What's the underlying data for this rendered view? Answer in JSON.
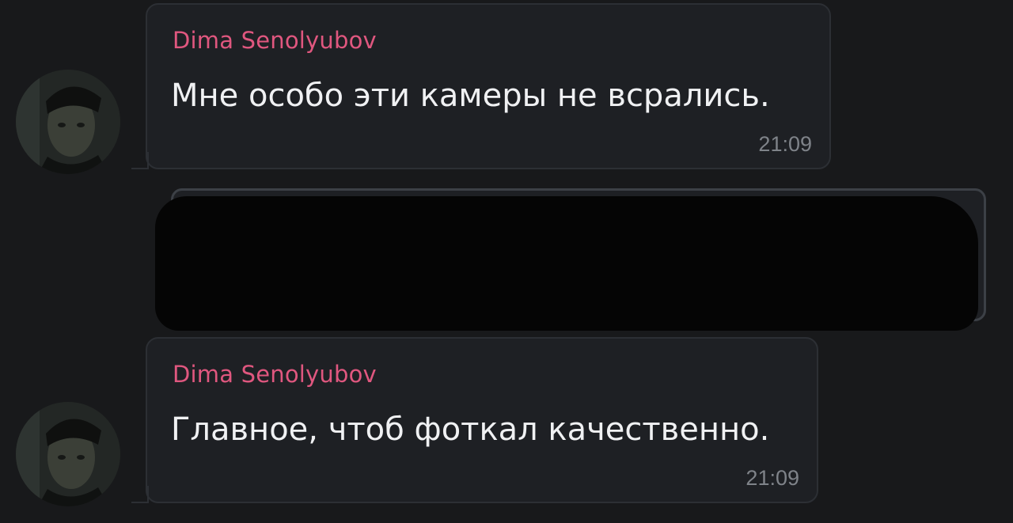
{
  "messages": [
    {
      "sender": "Dima Senolyubov",
      "text": "Мне особо эти камеры не всрались.",
      "time": "21:09"
    },
    {
      "sender": "Dima Senolyubov",
      "text": "Главное, чтоб фоткал качественно.",
      "time": "21:09"
    }
  ],
  "colors": {
    "background": "#18191b",
    "bubble": "#1e2024",
    "sender_name": "#e0577f",
    "message_text": "#f0f1f3",
    "timestamp": "#7f8389"
  }
}
